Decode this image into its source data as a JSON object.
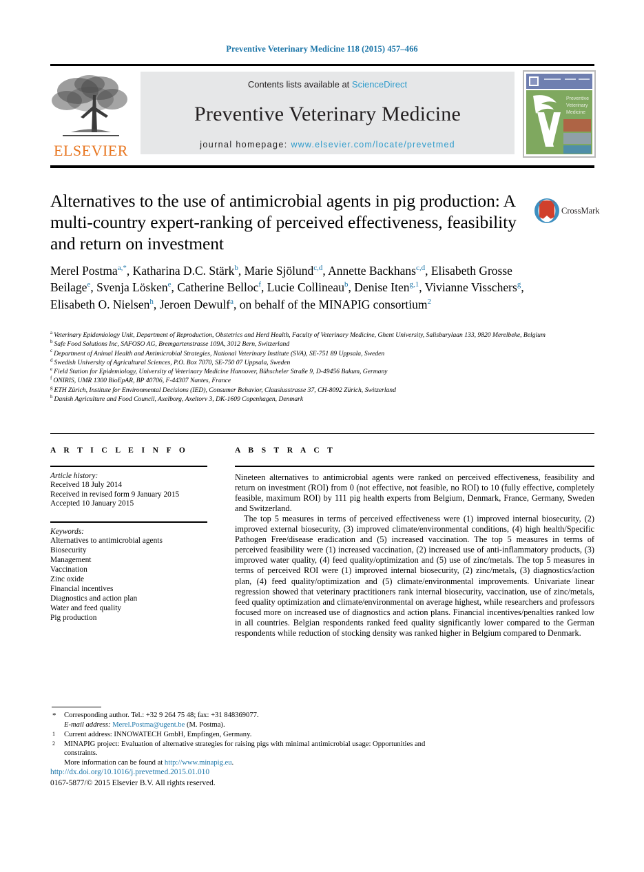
{
  "running_head": "Preventive Veterinary Medicine 118 (2015) 457–466",
  "masthead": {
    "publisher_name": "ELSEVIER",
    "contents_prefix": "Contents lists available at ",
    "contents_link": "ScienceDirect",
    "journal_name": "Preventive Veterinary Medicine",
    "homepage_label": "journal homepage:",
    "homepage_url": "www.elsevier.com/locate/prevetmed",
    "cover_title_lines": [
      "Preventive",
      "Veterinary",
      "Medicine"
    ],
    "accent_orange": "#e87722",
    "link_blue": "#2e9bcb",
    "panel_grey": "#e6e7e8"
  },
  "crossmark": {
    "label": "CrossMark"
  },
  "title": "Alternatives to the use of antimicrobial agents in pig production: A multi-country expert-ranking of perceived effectiveness, feasibility and return on investment",
  "authors_html": "Merel Postma<sup>a,*</sup>, Katharina D.C. Stärk<sup>b</sup>, Marie Sjölund<sup>c,d</sup>, Annette Backhans<sup>c,d</sup>, Elisabeth Grosse Beilage<sup>e</sup>, Svenja Lösken<sup>e</sup>, Catherine Belloc<sup>f</sup>, Lucie Collineau<sup>b</sup>, Denise Iten<sup>g,1</sup>, Vivianne Visschers<sup>g</sup>, Elisabeth O. Nielsen<sup>h</sup>, Jeroen Dewulf<sup>a</sup>, on behalf of the MINAPIG consortium<sup>2</sup>",
  "affiliations": [
    {
      "mark": "a",
      "text": "Veterinary Epidemiology Unit, Department of Reproduction, Obstetrics and Herd Health, Faculty of Veterinary Medicine, Ghent University, Salisburylaan 133, 9820 Merelbeke, Belgium"
    },
    {
      "mark": "b",
      "text": "Safe Food Solutions Inc, SAFOSO AG, Bremgartenstrasse 109A, 3012 Bern, Switzerland"
    },
    {
      "mark": "c",
      "text": "Department of Animal Health and Antimicrobial Strategies, National Veterinary Institute (SVA), SE-751 89 Uppsala, Sweden"
    },
    {
      "mark": "d",
      "text": "Swedish University of Agricultural Sciences, P.O. Box 7070, SE-750 07 Uppsala, Sweden"
    },
    {
      "mark": "e",
      "text": "Field Station for Epidemiology, University of Veterinary Medicine Hannover, Bühscheler Straße 9, D-49456 Bakum, Germany"
    },
    {
      "mark": "f",
      "text": "ONIRIS, UMR 1300 BioEpAR, BP 40706, F-44307 Nantes, France"
    },
    {
      "mark": "g",
      "text": "ETH Zürich, Institute for Environmental Decisions (IED), Consumer Behavior, Clausiusstrasse 37, CH-8092 Zürich, Switzerland"
    },
    {
      "mark": "h",
      "text": "Danish Agriculture and Food Council, Axelborg, Axeltorv 3, DK-1609 Copenhagen, Denmark"
    }
  ],
  "article_info": {
    "heading": "A R T I C L E   I N F O",
    "history_label": "Article history:",
    "history": [
      "Received 18 July 2014",
      "Received in revised form 9 January 2015",
      "Accepted 10 January 2015"
    ],
    "keywords_label": "Keywords:",
    "keywords": [
      "Alternatives to antimicrobial agents",
      "Biosecurity",
      "Management",
      "Vaccination",
      "Zinc oxide",
      "Financial incentives",
      "Diagnostics and action plan",
      "Water and feed quality",
      "Pig production"
    ]
  },
  "abstract": {
    "heading": "A B S T R A C T",
    "paragraphs": [
      "Nineteen alternatives to antimicrobial agents were ranked on perceived effectiveness, feasibility and return on investment (ROI) from 0 (not effective, not feasible, no ROI) to 10 (fully effective, completely feasible, maximum ROI) by 111 pig health experts from Belgium, Denmark, France, Germany, Sweden and Switzerland.",
      "The top 5 measures in terms of perceived effectiveness were (1) improved internal biosecurity, (2) improved external biosecurity, (3) improved climate/environmental conditions, (4) high health/Specific Pathogen Free/disease eradication and (5) increased vaccination. The top 5 measures in terms of perceived feasibility were (1) increased vaccination, (2) increased use of anti-inflammatory products, (3) improved water quality, (4) feed quality/optimization and (5) use of zinc/metals. The top 5 measures in terms of perceived ROI were (1) improved internal biosecurity, (2) zinc/metals, (3) diagnostics/action plan, (4) feed quality/optimization and (5) climate/environmental improvements. Univariate linear regression showed that veterinary practitioners rank internal biosecurity, vaccination, use of zinc/metals, feed quality optimization and climate/environmental on average highest, while researchers and professors focused more on increased use of diagnostics and action plans. Financial incentives/penalties ranked low in all countries. Belgian respondents ranked feed quality significantly lower compared to the German respondents while reduction of stocking density was ranked higher in Belgium compared to Denmark."
    ]
  },
  "footnotes": {
    "corresponding": "Corresponding author. Tel.: +32 9 264 75 48; fax: +31 848369077.",
    "email_label": "E-mail address:",
    "email": "Merel.Postma@ugent.be",
    "email_suffix": "(M. Postma).",
    "note1": "Current address: INNOWATECH GmbH, Empfingen, Germany.",
    "note2": "MINAPIG project: Evaluation of alternative strategies for raising pigs with minimal antimicrobial usage: Opportunities and constraints.",
    "note2_tail_prefix": "More information can be found at ",
    "note2_tail_link": "http://www.minapig.eu",
    "note2_tail_suffix": "."
  },
  "doi": "http://dx.doi.org/10.1016/j.prevetmed.2015.01.010",
  "copyright": "0167-5877/© 2015 Elsevier B.V. All rights reserved."
}
